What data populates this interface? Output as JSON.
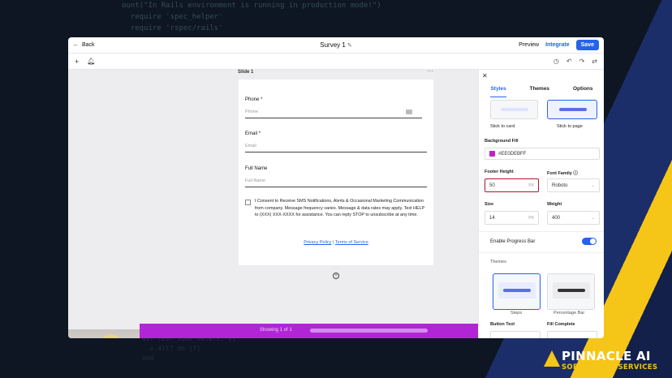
{
  "bg_code": {
    "line1": "ount(\"In Rails environment is running in production mode!\")",
    "line2": "  require 'spec_helper'",
    "line3": "  require 'rspec/rails'",
    "bottom1": "def test_some_data(x, y)",
    "bottom2": "  x.all? do |f|",
    "bottom3": "end"
  },
  "topbar": {
    "back_label": "Back",
    "title": "Survey 1",
    "preview": "Preview",
    "integrate": "Integrate",
    "save": "Save"
  },
  "slide": {
    "label": "Slide 1"
  },
  "form": {
    "phone_label": "Phone",
    "phone_placeholder": "Phone",
    "email_label": "Email",
    "email_placeholder": "Email",
    "fullname_label": "Full Name",
    "fullname_placeholder": "Full Name",
    "required_mark": "*",
    "consent_text": "I Consent to Receive SMS Notifications, Alerts & Occasional Marketing Communication from company. Message frequency varies. Message & data rates may apply. Text HELP to (XXX) XXX-XXXX for assistance. You can reply STOP to unsubscribe at any time.",
    "privacy_link": "Privacy Policy",
    "separator": " | ",
    "terms_link": "Terms of Service"
  },
  "footer": {
    "showing": "Showing 1 of 1"
  },
  "panel": {
    "tabs": [
      "Styles",
      "Themes",
      "Options"
    ],
    "stick_card": "Stick to card",
    "stick_page": "Stick to page",
    "bg_fill_label": "Background Fill",
    "bg_fill_value": "#EE0DEBFF",
    "bg_fill_color": "#c321c9",
    "footer_height_label": "Footer Height",
    "footer_height_value": "50",
    "font_family_label": "Font Family",
    "font_family_value": "Roboto",
    "size_label": "Size",
    "size_value": "14",
    "weight_label": "Weight",
    "weight_value": "400",
    "px": "PX",
    "enable_progress": "Enable Progress Bar",
    "themes_label": "Themes",
    "theme_steps": "Steps",
    "theme_percentage": "Percentage Bar",
    "button_text_label": "Button Text",
    "fill_complete_label": "Fill Complete"
  },
  "brand": {
    "name": "PINNACLE AI",
    "tagline": "SOFTWARE & SERVICES",
    "accent": "#f5c518"
  }
}
